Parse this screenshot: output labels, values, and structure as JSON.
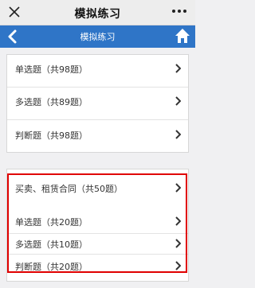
{
  "window": {
    "title": "模拟练习",
    "close_icon": "close-icon",
    "more_icon": "more-icon"
  },
  "navbar": {
    "title": "模拟练习",
    "back_icon": "chevron-left-icon",
    "home_icon": "home-icon",
    "color": "#2f75c7"
  },
  "group1": {
    "items": [
      {
        "label": "单选题（共98题）",
        "icon": "chevron-right-icon"
      },
      {
        "label": "多选题（共89题）",
        "icon": "chevron-right-icon"
      },
      {
        "label": "判断题（共98题）",
        "icon": "chevron-right-icon"
      }
    ]
  },
  "group2": {
    "header": {
      "label": "买卖、租赁合同（共50题）",
      "icon": "chevron-right-icon"
    },
    "items": [
      {
        "label": "单选题（共20题）",
        "icon": "chevron-right-icon"
      },
      {
        "label": "多选题（共10题）",
        "icon": "chevron-right-icon"
      },
      {
        "label": "判断题（共20题）",
        "icon": "chevron-right-icon"
      }
    ],
    "highlight_color": "#e00000"
  }
}
